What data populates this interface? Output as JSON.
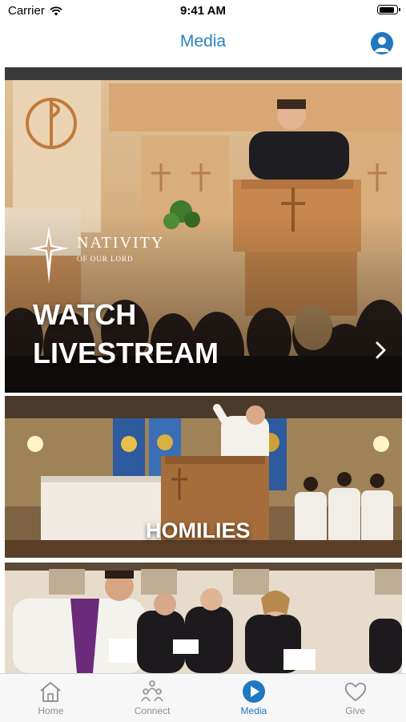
{
  "status_bar": {
    "carrier": "Carrier",
    "time": "9:41 AM"
  },
  "header": {
    "title": "Media"
  },
  "logo": {
    "name": "NATIVITY",
    "subtitle": "OF OUR LORD"
  },
  "cards": [
    {
      "title_line1": "WATCH",
      "title_line2": "LIVESTREAM"
    },
    {
      "title": "HOMILIES"
    }
  ],
  "tabs": [
    {
      "label": "Home",
      "icon": "home-icon"
    },
    {
      "label": "Connect",
      "icon": "connect-icon"
    },
    {
      "label": "Media",
      "icon": "media-icon"
    },
    {
      "label": "Give",
      "icon": "give-icon"
    }
  ],
  "colors": {
    "accent": "#1f78c0",
    "inactive": "#8e8e8e"
  }
}
